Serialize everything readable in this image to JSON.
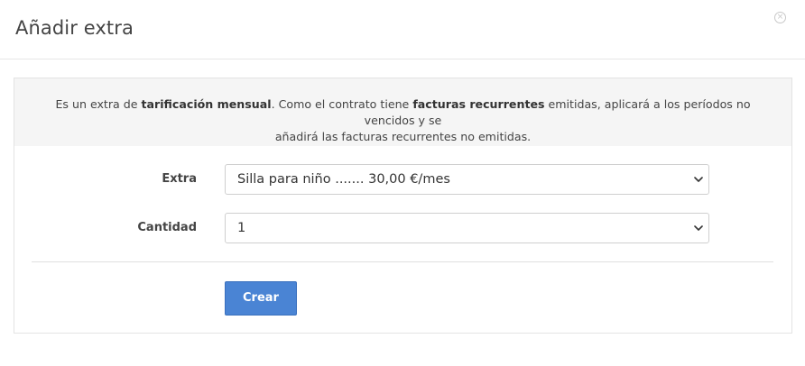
{
  "modal": {
    "title": "Añadir extra",
    "close_icon": "close-circle-icon"
  },
  "notice": {
    "part1": "Es un extra de ",
    "bold1": "tarificación mensual",
    "part2": ". Como el contrato tiene ",
    "bold2": "facturas recurrentes",
    "part3": " emitidas, aplicará a los períodos no vencidos y se",
    "line2": "añadirá las facturas recurrentes no emitidas."
  },
  "form": {
    "extra_label": "Extra",
    "extra_value": "Silla para niño ....... 30,00 €/mes",
    "cantidad_label": "Cantidad",
    "cantidad_value": "1",
    "submit_label": "Crear"
  },
  "colors": {
    "primary_button": "#4a84d4",
    "notice_background": "#f5f5f5"
  }
}
